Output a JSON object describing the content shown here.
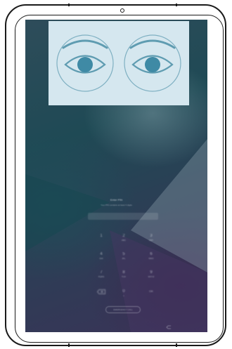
{
  "lock_screen": {
    "title": "Enter PIN",
    "subtitle": "Your PIN contains at least 4 digits",
    "keypad": [
      {
        "num": "1",
        "sub": ""
      },
      {
        "num": "2",
        "sub": "ABC"
      },
      {
        "num": "3",
        "sub": "DEF"
      },
      {
        "num": "4",
        "sub": "GHI"
      },
      {
        "num": "5",
        "sub": "JKL"
      },
      {
        "num": "6",
        "sub": "MNO"
      },
      {
        "num": "7",
        "sub": "PQRS"
      },
      {
        "num": "8",
        "sub": "TUV"
      },
      {
        "num": "9",
        "sub": "WXYZ"
      },
      {
        "num": "0",
        "sub": "+"
      },
      {
        "num": "OK",
        "sub": ""
      }
    ],
    "emergency_label": "EMERGENCY CALL"
  },
  "icons": {
    "camera": "camera-icon",
    "eye": "eye-icon",
    "delete": "backspace-icon",
    "back": "back-icon"
  },
  "colors": {
    "iris_panel_bg": "#d5e7ef",
    "eye_stroke": "#5f9cb1",
    "pupil": "#3f8aa5"
  }
}
